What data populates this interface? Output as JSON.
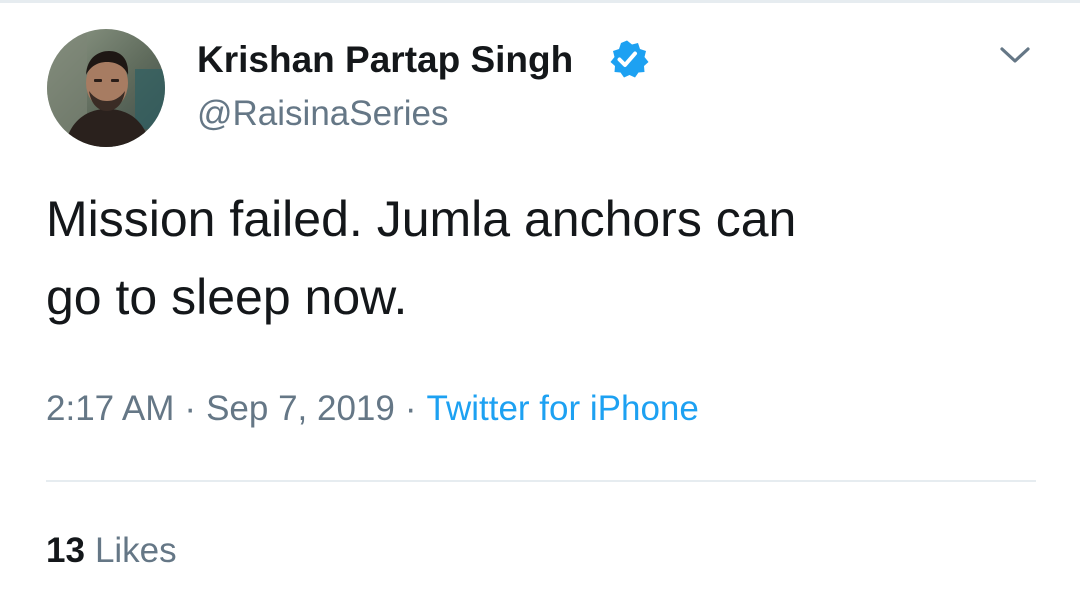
{
  "tweet": {
    "author": {
      "name": "Krishan Partap Singh",
      "handle": "@RaisinaSeries",
      "verified": true,
      "avatar_icon": "user-avatar-photo"
    },
    "menu_icon": "chevron-down-icon",
    "text_line1": "Mission failed. Jumla anchors can",
    "text_line2": "go to sleep now.",
    "time": "2:17 AM",
    "separator": "·",
    "date": "Sep 7, 2019",
    "source": "Twitter for iPhone",
    "likes_count": "13",
    "likes_label": "Likes"
  },
  "colors": {
    "text_primary": "#14171a",
    "text_secondary": "#657786",
    "link": "#1da1f2",
    "verified_badge": "#1da1f2",
    "divider": "#e6ecf0",
    "background": "#ffffff"
  }
}
